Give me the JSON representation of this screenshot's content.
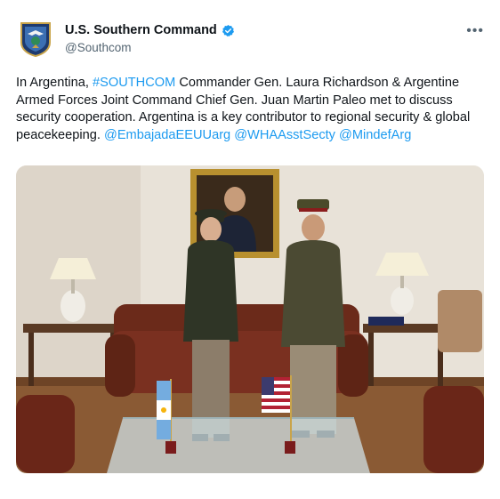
{
  "account": {
    "display_name": "U.S. Southern Command",
    "handle": "@Southcom",
    "verified_icon": "verified-badge-icon",
    "more_icon": "more-options-icon",
    "more_label": "•••"
  },
  "tweet": {
    "segments": [
      {
        "text": "In Argentina, ",
        "type": "text"
      },
      {
        "text": "#SOUTHCOM",
        "type": "link"
      },
      {
        "text": " Commander Gen. Laura Richardson & Argentine Armed Forces Joint Command Chief Gen. Juan Martin Paleo met to discuss security cooperation. Argentina is a key contributor to regional security & global peacekeeping. ",
        "type": "text"
      },
      {
        "text": "@EmbajadaEEUUarg",
        "type": "link"
      },
      {
        "text": " ",
        "type": "text"
      },
      {
        "text": "@WHAAsstSecty",
        "type": "link"
      },
      {
        "text": " ",
        "type": "text"
      },
      {
        "text": "@MindefArg",
        "type": "link"
      }
    ]
  },
  "photo": {
    "subject": "two generals in dress uniform standing in front of a sofa, portrait painting behind, Argentine and US desk flags in foreground"
  },
  "colors": {
    "link": "#1d9bf0",
    "verified": "#1d9bf0",
    "secondary_text": "#536471"
  }
}
